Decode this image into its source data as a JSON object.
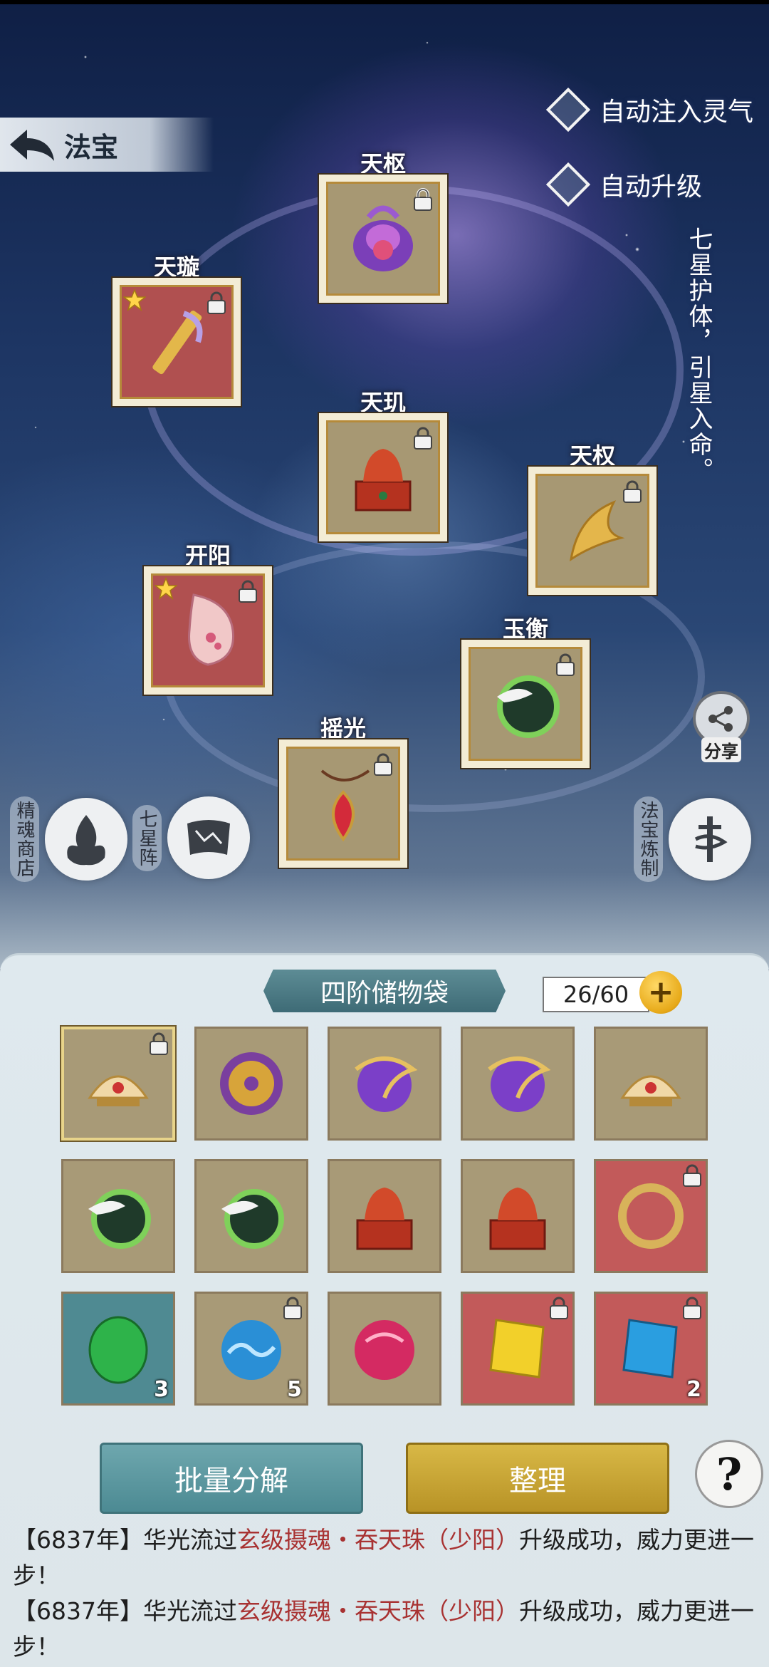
{
  "header": {
    "title": "法宝"
  },
  "toggles": [
    {
      "label": "自动注入灵气"
    },
    {
      "label": "自动升级"
    }
  ],
  "motto": "七星护体，引星入命。",
  "slots": [
    {
      "name": "天枢",
      "icon": "purple-spirit-beast-icon",
      "locked": true,
      "starred": false
    },
    {
      "name": "天璇",
      "icon": "jade-scepter-icon",
      "locked": true,
      "starred": true
    },
    {
      "name": "天玑",
      "icon": "red-dragon-seal-icon",
      "locked": true,
      "starred": false
    },
    {
      "name": "天权",
      "icon": "golden-feather-fan-icon",
      "locked": true,
      "starred": false
    },
    {
      "name": "开阳",
      "icon": "plum-blossom-vase-icon",
      "locked": true,
      "starred": true
    },
    {
      "name": "玉衡",
      "icon": "crane-jade-orb-icon",
      "locked": true,
      "starred": false
    },
    {
      "name": "摇光",
      "icon": "red-gem-pendant-icon",
      "locked": true,
      "starred": false
    }
  ],
  "side_buttons": {
    "spirit_shop": "精魂商店",
    "seven_star_array": "七星阵",
    "refine": "法宝炼制",
    "share": "分享"
  },
  "bag": {
    "title": "四阶储物袋",
    "capacity": "26/60",
    "items": [
      {
        "icon": "golden-lotus-crown-icon",
        "bg": "tan",
        "locked": true,
        "count": "",
        "selected": true
      },
      {
        "icon": "purple-jade-disc-icon",
        "bg": "tan",
        "locked": false,
        "count": "",
        "selected": false
      },
      {
        "icon": "purple-dragon-orb-icon",
        "bg": "tan",
        "locked": false,
        "count": "",
        "selected": false
      },
      {
        "icon": "purple-dragon-orb-icon",
        "bg": "tan",
        "locked": false,
        "count": "",
        "selected": false
      },
      {
        "icon": "golden-lotus-crown-icon",
        "bg": "tan",
        "locked": false,
        "count": "",
        "selected": false
      },
      {
        "icon": "crane-jade-orb-icon",
        "bg": "tan",
        "locked": false,
        "count": "",
        "selected": false
      },
      {
        "icon": "crane-jade-orb-icon",
        "bg": "tan",
        "locked": false,
        "count": "",
        "selected": false
      },
      {
        "icon": "red-dragon-seal-icon",
        "bg": "tan",
        "locked": false,
        "count": "",
        "selected": false
      },
      {
        "icon": "red-dragon-seal-icon",
        "bg": "tan",
        "locked": false,
        "count": "",
        "selected": false
      },
      {
        "icon": "golden-ring-icon",
        "bg": "red",
        "locked": true,
        "count": "",
        "selected": false
      },
      {
        "icon": "green-jade-egg-icon",
        "bg": "teal",
        "locked": false,
        "count": "3",
        "selected": false
      },
      {
        "icon": "blue-wave-pearl-icon",
        "bg": "tan",
        "locked": true,
        "count": "5",
        "selected": false
      },
      {
        "icon": "crimson-pearl-icon",
        "bg": "tan",
        "locked": false,
        "count": "",
        "selected": false
      },
      {
        "icon": "yellow-crystal-icon",
        "bg": "red",
        "locked": true,
        "count": "",
        "selected": false
      },
      {
        "icon": "blue-crystal-icon",
        "bg": "red",
        "locked": true,
        "count": "2",
        "selected": false
      }
    ]
  },
  "actions": {
    "batch_decompose": "批量分解",
    "sort": "整理",
    "help": "?"
  },
  "log": [
    {
      "prefix": "【6837年】华光流过",
      "item": "玄级摄魂・吞天珠（少阳）",
      "suffix": "升级成功，威力更进一步！"
    },
    {
      "prefix": "【6837年】华光流过",
      "item": "玄级摄魂・吞天珠（少阳）",
      "suffix": "升级成功，威力更进一步！"
    }
  ],
  "colors": {
    "slot_tan": "#a79873",
    "slot_red": "#b05050",
    "button_teal": "#4c8a93",
    "button_gold": "#b89326",
    "highlight_text": "#a83232"
  }
}
